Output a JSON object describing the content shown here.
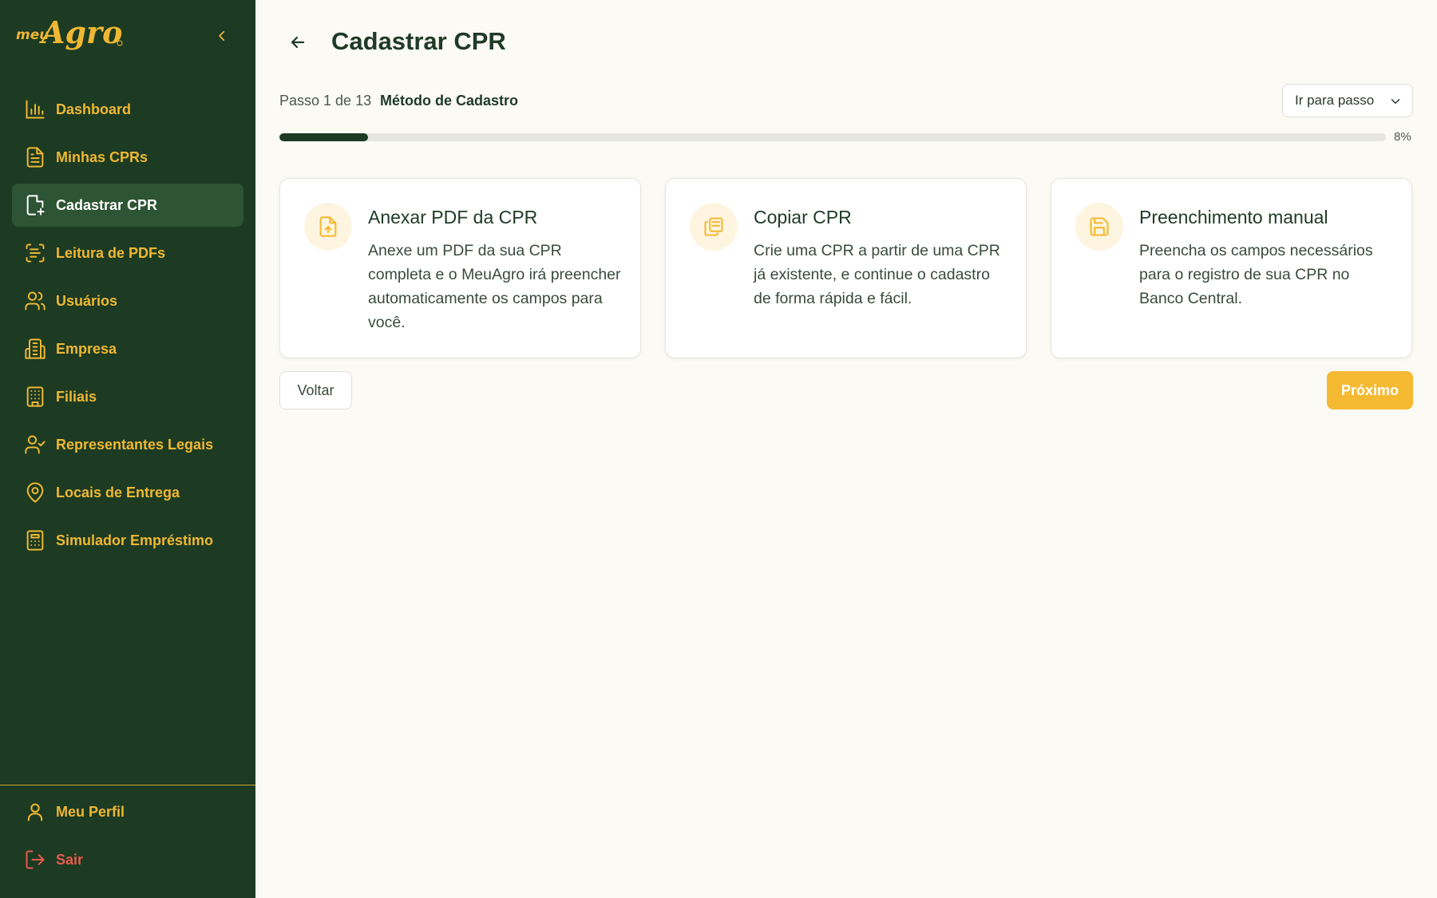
{
  "sidebar": {
    "logo_text": "meuAgro",
    "items": [
      {
        "label": "Dashboard",
        "icon": "bar-chart-icon"
      },
      {
        "label": "Minhas CPRs",
        "icon": "document-icon"
      },
      {
        "label": "Cadastrar CPR",
        "icon": "document-plus-icon",
        "active": true
      },
      {
        "label": "Leitura de PDFs",
        "icon": "scan-text-icon"
      },
      {
        "label": "Usuários",
        "icon": "users-icon"
      },
      {
        "label": "Empresa",
        "icon": "building-icon"
      },
      {
        "label": "Filiais",
        "icon": "office-building-icon"
      },
      {
        "label": "Representantes Legais",
        "icon": "user-check-icon"
      },
      {
        "label": "Locais de Entrega",
        "icon": "map-pin-icon"
      },
      {
        "label": "Simulador Empréstimo",
        "icon": "calculator-icon"
      }
    ],
    "bottom": [
      {
        "label": "Meu Perfil",
        "icon": "user-icon"
      },
      {
        "label": "Sair",
        "icon": "logout-icon"
      }
    ]
  },
  "header": {
    "title": "Cadastrar CPR"
  },
  "stepper": {
    "step_text": "Passo 1 de 13",
    "step_name": "Método de Cadastro",
    "goto_label": "Ir para passo",
    "progress_label": "8%",
    "progress_fraction": 0.08
  },
  "options": [
    {
      "title": "Anexar PDF da CPR",
      "description": "Anexe um PDF da sua CPR completa e o MeuAgro irá preencher automaticamente os campos para você.",
      "icon": "file-upload-icon"
    },
    {
      "title": "Copiar CPR",
      "description": "Crie uma CPR a partir de uma CPR já existente, e continue o cadastro de forma rápida e fácil.",
      "icon": "copy-icon"
    },
    {
      "title": "Preenchimento manual",
      "description": "Preencha os campos necessários para o registro de sua CPR no Banco Central.",
      "icon": "save-icon"
    }
  ],
  "actions": {
    "back_label": "Voltar",
    "next_label": "Próximo"
  },
  "colors": {
    "sidebar_bg": "#1c3b22",
    "accent": "#f5b932",
    "active_item_bg": "#2d5434",
    "logout_red": "#e8594e",
    "page_bg": "#fbfaf4"
  }
}
